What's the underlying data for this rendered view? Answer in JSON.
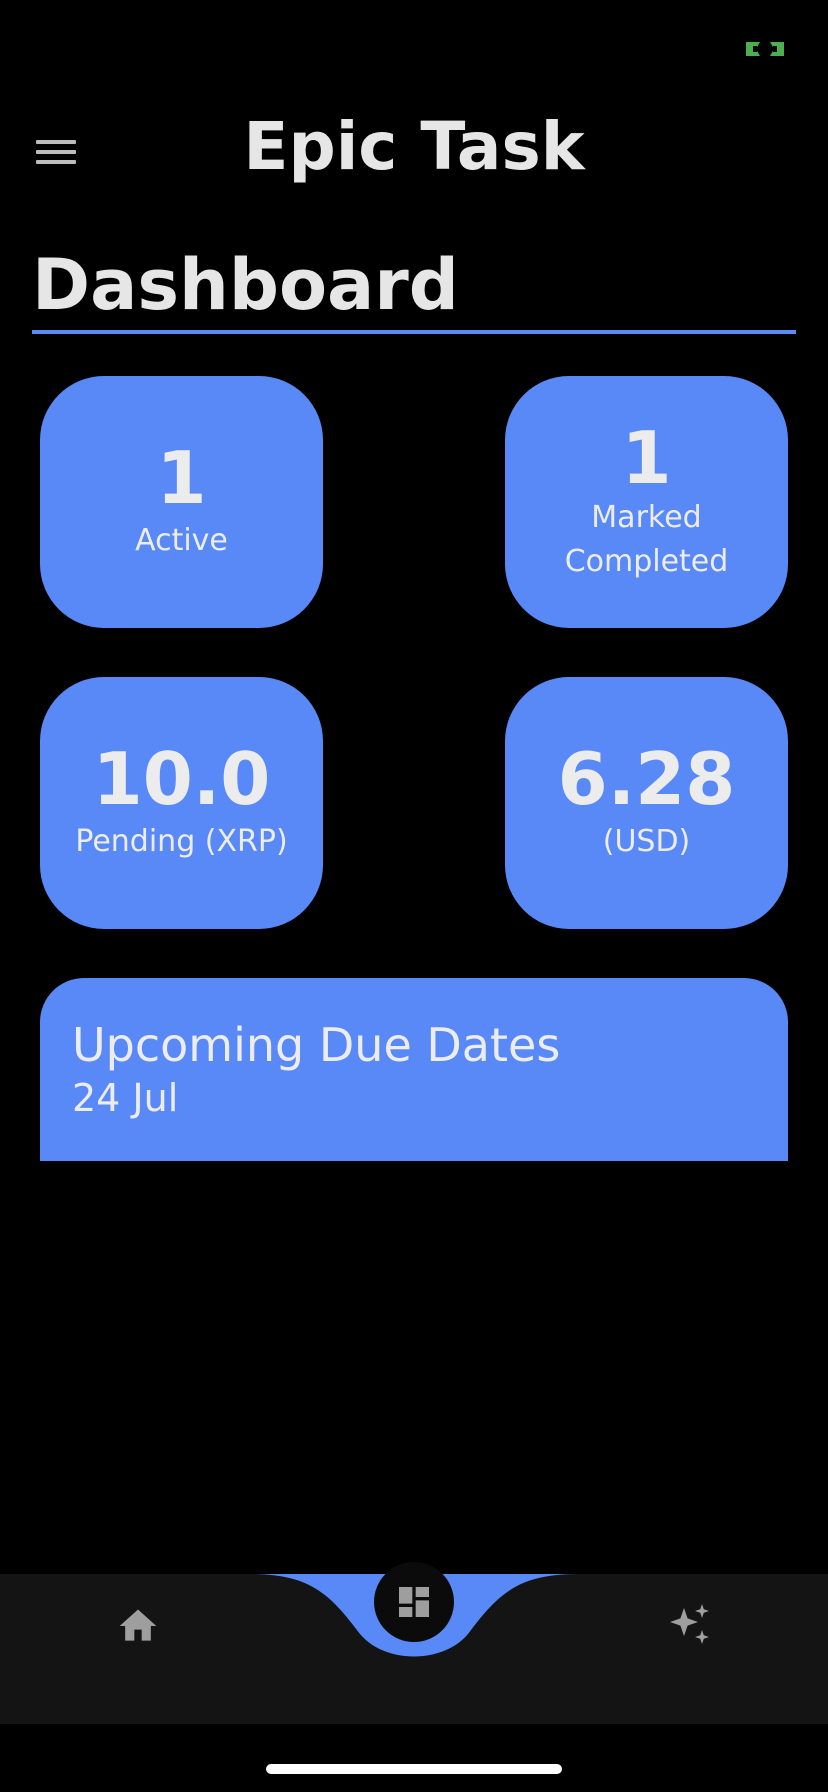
{
  "header": {
    "title": "Epic Task",
    "menu_icon": "hamburger-menu-icon"
  },
  "page": {
    "title": "Dashboard"
  },
  "stats": {
    "active": {
      "value": "1",
      "label": "Active"
    },
    "completed": {
      "value": "1",
      "label_line1": "Marked",
      "label_line2": "Completed"
    },
    "pending": {
      "value": "10.0",
      "label": "Pending (XRP)"
    },
    "usd": {
      "value": "6.28",
      "label": "(USD)"
    }
  },
  "upcoming": {
    "title": "Upcoming Due Dates",
    "date": "24 Jul"
  },
  "nav": {
    "items": [
      "home-icon",
      "dashboard-icon",
      "sparkle-icon"
    ],
    "active": "dashboard-icon"
  },
  "colors": {
    "accent": "#5889f6",
    "background": "#000000",
    "nav_background": "#141414",
    "status_indicator": "#4caf50"
  }
}
